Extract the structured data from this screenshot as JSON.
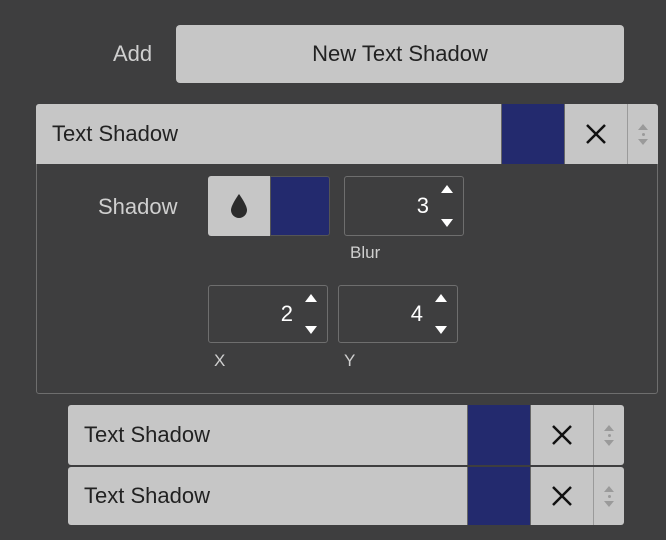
{
  "add": {
    "label": "Add",
    "button_label": "New Text Shadow"
  },
  "shadows": [
    {
      "title": "Text Shadow",
      "color": "#232a6e",
      "expanded": true,
      "shadow_label": "Shadow",
      "blur": {
        "value": "3",
        "label": "Blur"
      },
      "x": {
        "value": "2",
        "label": "X"
      },
      "y": {
        "value": "4",
        "label": "Y"
      }
    },
    {
      "title": "Text Shadow",
      "color": "#232a6e",
      "expanded": false
    },
    {
      "title": "Text Shadow",
      "color": "#232a6e",
      "expanded": false
    }
  ],
  "icons": {
    "close": "close-icon",
    "drag": "drag-handle-icon",
    "color_drop": "drop-icon"
  }
}
